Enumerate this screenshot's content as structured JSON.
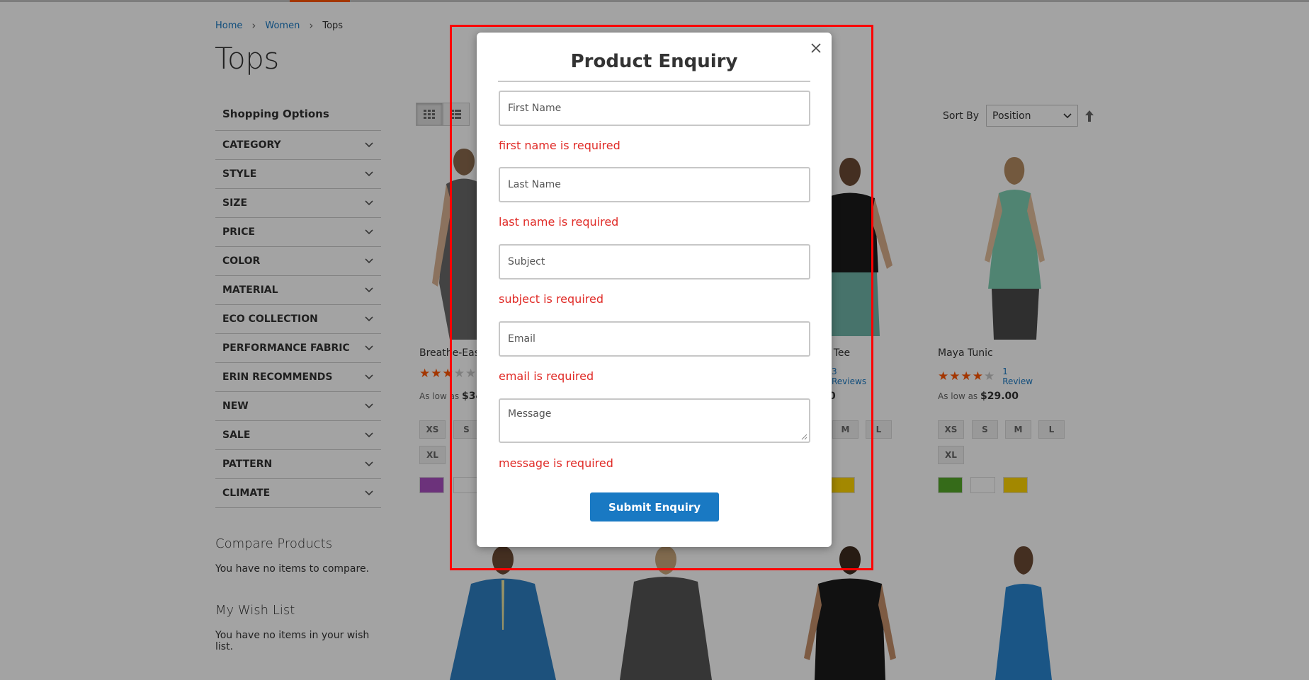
{
  "breadcrumb": {
    "home": "Home",
    "women": "Women",
    "current": "Tops"
  },
  "page_title": "Tops",
  "sidebar": {
    "shopping_options": "Shopping Options",
    "filters": [
      "CATEGORY",
      "STYLE",
      "SIZE",
      "PRICE",
      "COLOR",
      "MATERIAL",
      "ECO COLLECTION",
      "PERFORMANCE FABRIC",
      "ERIN RECOMMENDS",
      "NEW",
      "SALE",
      "PATTERN",
      "CLIMATE"
    ],
    "compare_title": "Compare Products",
    "compare_text": "You have no items to compare.",
    "wishlist_title": "My Wish List",
    "wishlist_text": "You have no items in your wish list."
  },
  "toolbar": {
    "sort_label": "Sort By",
    "sort_value": "Position"
  },
  "products": {
    "p1": {
      "name": "Breathe-Easy",
      "as_low_as": "As low as",
      "price": "$34.",
      "sizes": [
        "XS",
        "S",
        "XL"
      ],
      "stars": 3.5
    },
    "p3": {
      "name": "s Tee",
      "reviews_count": "3",
      "reviews_label": "Reviews",
      "price_frag": "0",
      "sizes": [
        "M",
        "L"
      ]
    },
    "p4": {
      "name": "Maya Tunic",
      "stars": 4,
      "reviews_count": "1",
      "reviews_label": "Review",
      "as_low_as": "As low as",
      "price": "$29.00",
      "sizes": [
        "XS",
        "S",
        "M",
        "L",
        "XL"
      ]
    }
  },
  "colors": {
    "accent": "#ff5501",
    "link": "#1979c3",
    "error": "#e02b27",
    "highlight": "#ff0000",
    "swatch_purple": "#a94fc1",
    "swatch_green": "#53a828",
    "swatch_white": "#ffffff",
    "swatch_yellow": "#ffd500"
  },
  "modal": {
    "title": "Product Enquiry",
    "fields": {
      "first_name": {
        "placeholder": "First Name",
        "error": "first name is required"
      },
      "last_name": {
        "placeholder": "Last Name",
        "error": "last name is required"
      },
      "subject": {
        "placeholder": "Subject",
        "error": "subject is required"
      },
      "email": {
        "placeholder": "Email",
        "error": "email is required"
      },
      "message": {
        "placeholder": "Message",
        "error": "message is required"
      }
    },
    "submit_label": "Submit Enquiry",
    "close_icon": "close-icon"
  }
}
